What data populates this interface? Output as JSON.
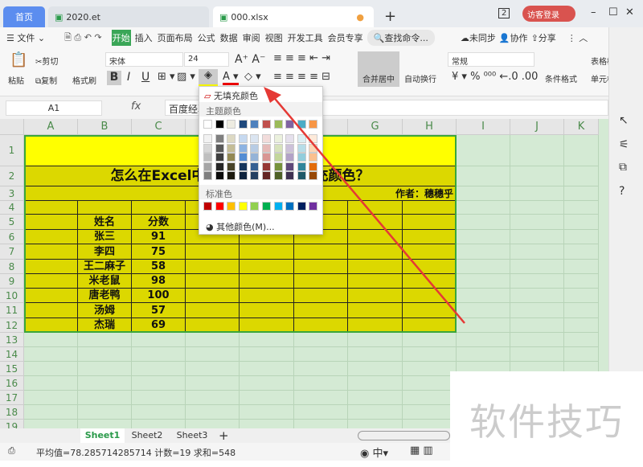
{
  "tabs": [
    {
      "label": "首页"
    },
    {
      "label": "2020.et"
    },
    {
      "label": "000.xlsx"
    }
  ],
  "titlebar": {
    "badge": "2",
    "login": "访客登录",
    "new_tab": "+"
  },
  "menu": {
    "file": "文件",
    "items": [
      "开始",
      "插入",
      "页面布局",
      "公式",
      "数据",
      "审阅",
      "视图",
      "开发工具",
      "会员专享"
    ],
    "search": "查找命令...",
    "sync": "未同步",
    "collab": "协作",
    "share": "分享"
  },
  "ribbon": {
    "paste": "粘贴",
    "cut": "剪切",
    "copy": "复制",
    "format_painter": "格式刷",
    "font": "宋体",
    "size": "24",
    "merge": "合并居中",
    "wrap": "自动换行",
    "number_format": "常规",
    "conditional": "条件格式",
    "table_style": "表格样式",
    "cell_format": "单元格格式",
    "bold": "B",
    "italic": "I",
    "underline": "U",
    "currency": "¥",
    "percent": "%"
  },
  "formula_bar": {
    "cell_ref": "A1",
    "fx": "fx",
    "value": "百度经验"
  },
  "columns": [
    "A",
    "B",
    "C",
    "D",
    "E",
    "F",
    "G",
    "H",
    "I",
    "J",
    "K"
  ],
  "rows": [
    "1",
    "2",
    "3",
    "4",
    "5",
    "6",
    "7",
    "8",
    "9",
    "10",
    "11",
    "12",
    "13",
    "14",
    "15",
    "16",
    "17",
    "18",
    "19"
  ],
  "sheet": {
    "title": "百度经验",
    "subtitle": "怎么在Excel中快速去除单元格填充颜色？",
    "author": "作者：穗穗乎",
    "headers": [
      "姓名",
      "分数"
    ],
    "records": [
      [
        "张三",
        "91"
      ],
      [
        "李四",
        "75"
      ],
      [
        "王二麻子",
        "58"
      ],
      [
        "米老鼠",
        "98"
      ],
      [
        "唐老鸭",
        "100"
      ],
      [
        "汤姆",
        "57"
      ],
      [
        "杰瑞",
        "69"
      ]
    ]
  },
  "dropdown": {
    "no_fill": "无填充颜色",
    "theme_label": "主题颜色",
    "standard_label": "标准色",
    "more": "其他颜色(M)...",
    "theme_top": [
      "#ffffff",
      "#000000",
      "#eeece1",
      "#1f497d",
      "#4f81bd",
      "#c0504d",
      "#9bbb59",
      "#8064a2",
      "#4bacc6",
      "#f79646"
    ],
    "theme_shades": [
      [
        "#f2f2f2",
        "#7f7f7f",
        "#ddd9c3",
        "#c6d9f0",
        "#dbe5f1",
        "#f2dcdb",
        "#ebf1dd",
        "#e5e0ec",
        "#dbeef3",
        "#fdeada"
      ],
      [
        "#d8d8d8",
        "#595959",
        "#c4bd97",
        "#8db3e2",
        "#b8cce4",
        "#e5b9b7",
        "#d7e3bc",
        "#ccc1d9",
        "#b7dde8",
        "#fbd5b5"
      ],
      [
        "#bfbfbf",
        "#3f3f3f",
        "#938953",
        "#548dd4",
        "#95b3d7",
        "#d99694",
        "#c3d69b",
        "#b2a2c7",
        "#92cddc",
        "#fac08f"
      ],
      [
        "#a5a5a5",
        "#262626",
        "#494429",
        "#17365d",
        "#366092",
        "#953734",
        "#76923c",
        "#5f497a",
        "#31859b",
        "#e36c09"
      ],
      [
        "#7f7f7f",
        "#0c0c0c",
        "#1d1b10",
        "#0f243e",
        "#244061",
        "#632423",
        "#4f6128",
        "#3f3151",
        "#205867",
        "#974806"
      ]
    ],
    "standard": [
      "#c00000",
      "#ff0000",
      "#ffc000",
      "#ffff00",
      "#92d050",
      "#00b050",
      "#00b0f0",
      "#0070c0",
      "#002060",
      "#7030a0"
    ]
  },
  "sheet_tabs": [
    "Sheet1",
    "Sheet2",
    "Sheet3"
  ],
  "status": {
    "text": "平均值=78.285714285714  计数=19  求和=548"
  },
  "watermark": "软件技巧",
  "colors": {
    "accent": "#4caf50",
    "fill": "#dcd800",
    "title_fill": "#ffff00"
  }
}
